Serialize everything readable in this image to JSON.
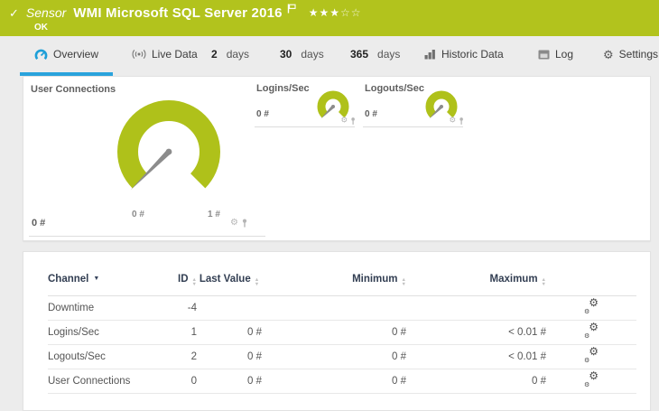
{
  "header": {
    "check": "✓",
    "kind": "Sensor",
    "title": "WMI Microsoft SQL Server 2016",
    "status": "OK",
    "stars": {
      "filled": "★★★",
      "empty": "☆☆"
    }
  },
  "tabs": {
    "overview": "Overview",
    "live_data": "Live Data",
    "d2_value": "2",
    "d2_unit": "days",
    "d30_value": "30",
    "d30_unit": "days",
    "d365_value": "365",
    "d365_unit": "days",
    "historic": "Historic Data",
    "log": "Log",
    "settings": "Settings"
  },
  "gauges": {
    "primary": {
      "title": "User Connections",
      "value": "0 #",
      "scale_min": "0 #",
      "scale_max": "1 #"
    },
    "logins": {
      "title": "Logins/Sec",
      "value": "0 #"
    },
    "logouts": {
      "title": "Logouts/Sec",
      "value": "0 #"
    },
    "action_icons": [
      "gear-icon",
      "pin-icon"
    ]
  },
  "table": {
    "headers": {
      "channel": "Channel",
      "id": "ID",
      "last_value": "Last Value",
      "minimum": "Minimum",
      "maximum": "Maximum"
    },
    "rows": [
      {
        "channel": "Downtime",
        "id": "-4",
        "last_value": "",
        "minimum": "",
        "maximum": ""
      },
      {
        "channel": "Logins/Sec",
        "id": "1",
        "last_value": "0 #",
        "minimum": "0 #",
        "maximum": "< 0.01 #"
      },
      {
        "channel": "Logouts/Sec",
        "id": "2",
        "last_value": "0 #",
        "minimum": "0 #",
        "maximum": "< 0.01 #"
      },
      {
        "channel": "User Connections",
        "id": "0",
        "last_value": "0 #",
        "minimum": "0 #",
        "maximum": "0 #"
      }
    ]
  },
  "colors": {
    "brand_green": "#b2c31d",
    "gauge_green": "#afc11a",
    "accent_blue": "#2aa3dc",
    "needle_gray": "#8c8c8c"
  }
}
